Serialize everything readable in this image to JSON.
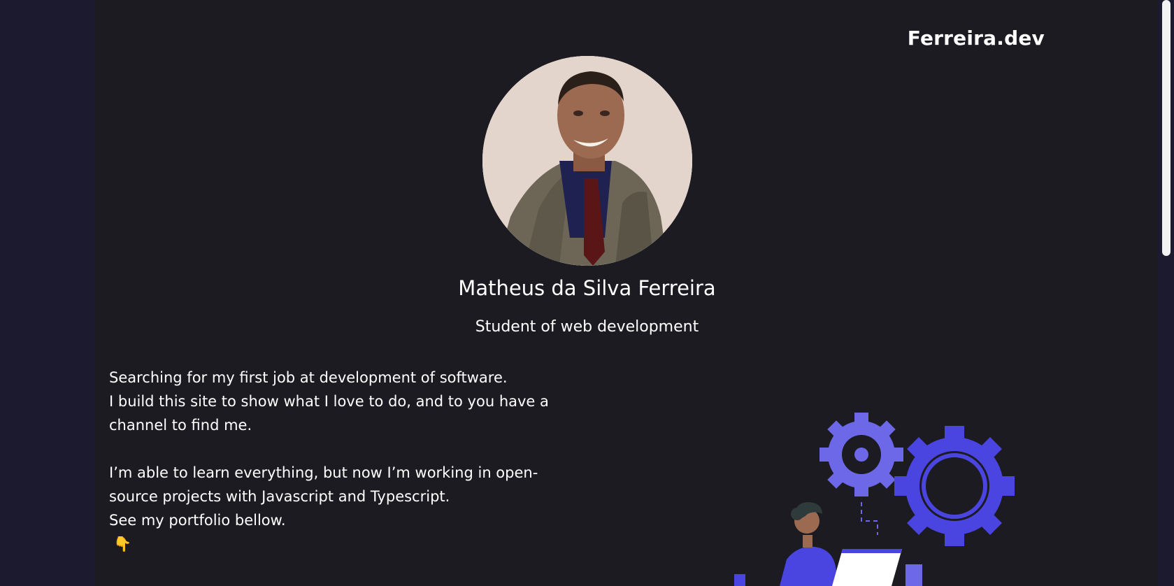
{
  "header": {
    "brand": "Ferreira.dev"
  },
  "profile": {
    "name": "Matheus da Silva Ferreira",
    "role": "Student of web development"
  },
  "about": {
    "paragraph1": {
      "line1": "Searching for my first job at development of software.",
      "line2": "I build this site to show what I love to do, and to you have a channel to find me."
    },
    "paragraph2": {
      "line1": "I’m able to learn everything, but now I’m working in open-source projects with Javascript and Typescript.",
      "line2": "See my portfolio bellow.",
      "emoji": "👇"
    }
  },
  "colors": {
    "background": "#1c1b22",
    "accent": "#4a45e0",
    "accent_light": "#6c68e8"
  }
}
